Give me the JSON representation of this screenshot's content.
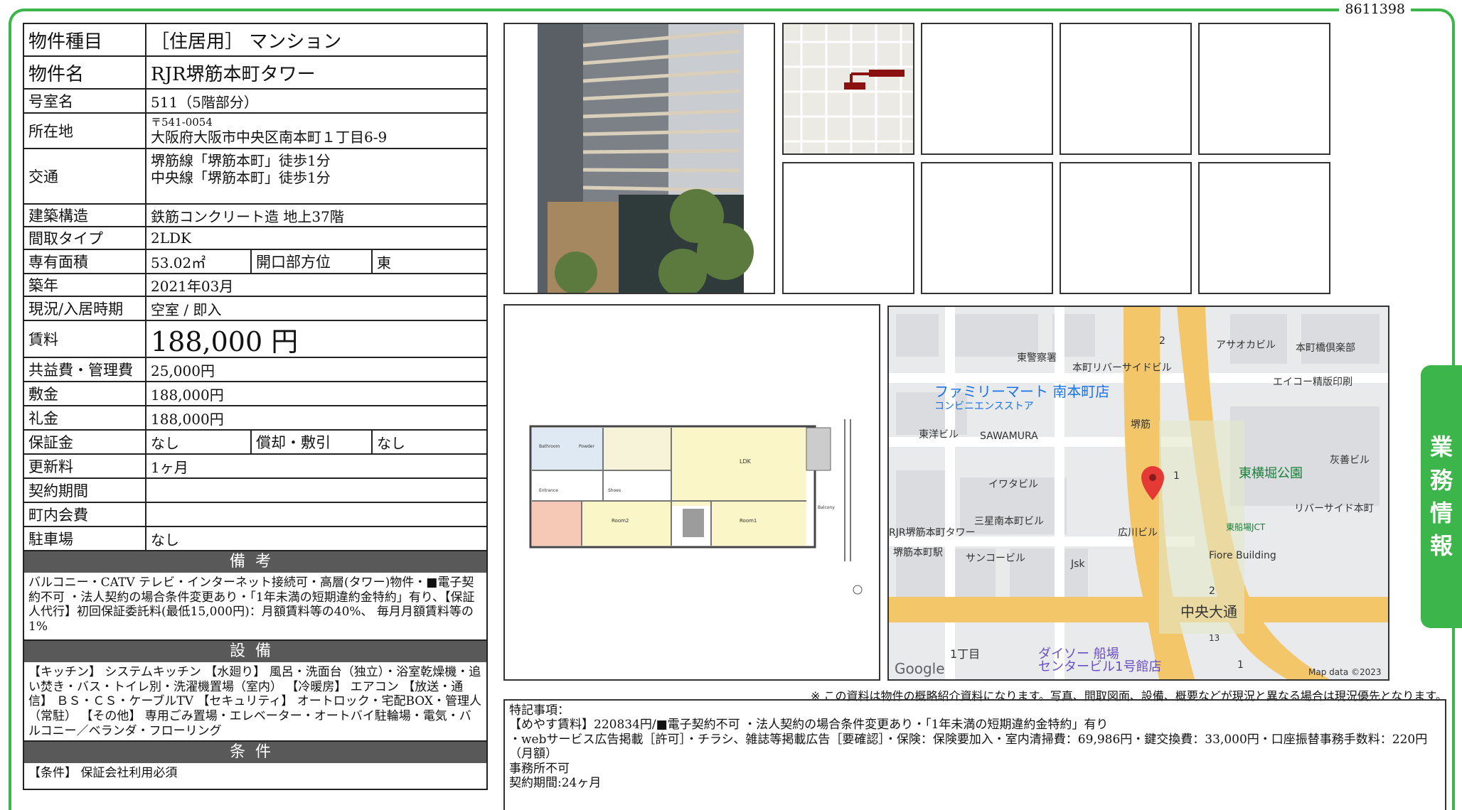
{
  "doc_number": "8611398",
  "property": {
    "type_label": "物件種目",
    "type_value": "［住居用］ マンション",
    "name_label": "物件名",
    "name_value": "RJR堺筋本町タワー",
    "room_label": "号室名",
    "room_value": "511（5階部分）",
    "address_label": "所在地",
    "postal": "〒541-0054",
    "address_value": "大阪府大阪市中央区南本町１丁目6-9",
    "access_label": "交通",
    "access_1": "堺筋線「堺筋本町」徒歩1分",
    "access_2": "中央線「堺筋本町」徒歩1分",
    "structure_label": "建築構造",
    "structure_value": "鉄筋コンクリート造 地上37階",
    "layout_label": "間取タイプ",
    "layout_value": "2LDK",
    "area_label": "専有面積",
    "area_value": "53.02㎡",
    "direction_label": "開口部方位",
    "direction_value": "東",
    "built_label": "築年",
    "built_value": "2021年03月",
    "status_label": "現況/入居時期",
    "status_value": "空室 / 即入",
    "rent_label": "賃料",
    "rent_value": "188,000 円",
    "fee_label": "共益費・管理費",
    "fee_value": "25,000円",
    "deposit_label": "敷金",
    "deposit_value": "188,000円",
    "key_label": "礼金",
    "key_value": "188,000円",
    "guarantee_label": "保証金",
    "guarantee_value": "なし",
    "amort_label": "償却・敷引",
    "amort_value": "なし",
    "renew_label": "更新料",
    "renew_value": "1ヶ月",
    "term_label": "契約期間",
    "term_value": "",
    "assoc_label": "町内会費",
    "assoc_value": "",
    "parking_label": "駐車場",
    "parking_value": "なし"
  },
  "remarks": {
    "heading": "備考",
    "text": "バルコニー・CATV テレビ・インターネット接続可・高層(タワー)物件・■電子契約不可 ・法人契約の場合条件変更あり・「1年未満の短期違約金特約」有り、【保証人代行】初回保証委託料(最低15,000円)：月額賃料等の40%、 毎月月額賃料等の1%"
  },
  "equipment": {
    "heading": "設備",
    "text": "【キッチン】 システムキッチン 【水廻り】 風呂・洗面台（独立）・浴室乾燥機・追い焚き・バス・トイレ別・洗濯機置場（室内） 【冷暖房】 エアコン 【放送・通信】 ＢＳ・ＣＳ・ケーブルTV 【セキュリティ】 オートロック・宅配BOX・管理人（常駐） 【その他】 専用ごみ置場・エレベーター・オートバイ駐輪場・電気・バルコニー／ベランダ・フローリング"
  },
  "conditions": {
    "heading": "条件",
    "text": "【条件】 保証会社利用必須"
  },
  "disclaimer": "※ この資料は物件の概略紹介資料になります。写真、間取図面、設備、概要などが現況と異なる場合は現況優先となります。",
  "special": {
    "line1": "特記事項：",
    "line2": "【めやす賃料】220834円/■電子契約不可 ・法人契約の場合条件変更あり・「1年未満の短期違約金特約」有り",
    "line3": "・webサービス広告掲載［許可］・チラシ、雑誌等掲載広告［要確認］・保険：保険要加入・室内清掃費：69,986円・鍵交換費：33,000円・口座振替事務手数料：220円（月額）",
    "line4": "事務所不可",
    "line5": "契約期間:24ヶ月"
  },
  "side_tab": [
    "業",
    "務",
    "情",
    "報"
  ],
  "map": {
    "labels": [
      "東警察署",
      "本町リバーサイドビル",
      "アサオカビル",
      "本町橋倶楽部",
      "ファミリーマート 南本町店",
      "コンビニエンスストア",
      "エイコー精版印刷",
      "東洋ビル",
      "SAWAMURA",
      "東横堀公園",
      "灰善ビル",
      "イワタビル",
      "リバーサイド本町",
      "三星南本町ビル",
      "広川ビル",
      "RJR堺筋本町タワー",
      "堺筋本町駅",
      "サンコービル",
      "Jsk",
      "Fiore Building",
      "東船場JCT",
      "中央大通",
      "1丁目",
      "ダイソー 船場",
      "センタービル1号館店",
      "Google",
      "Map data ©2023",
      "堺筋"
    ],
    "numbers": [
      "2",
      "1",
      "2",
      "1",
      "13"
    ]
  },
  "floorplan": {
    "rooms": [
      "LDK",
      "Room2",
      "Room1",
      "Balcony",
      "Bathroom",
      "Powder",
      "Entrance",
      "Shoes"
    ]
  },
  "colors": {
    "accent": "#3cb54a",
    "section_bg": "#595959"
  }
}
